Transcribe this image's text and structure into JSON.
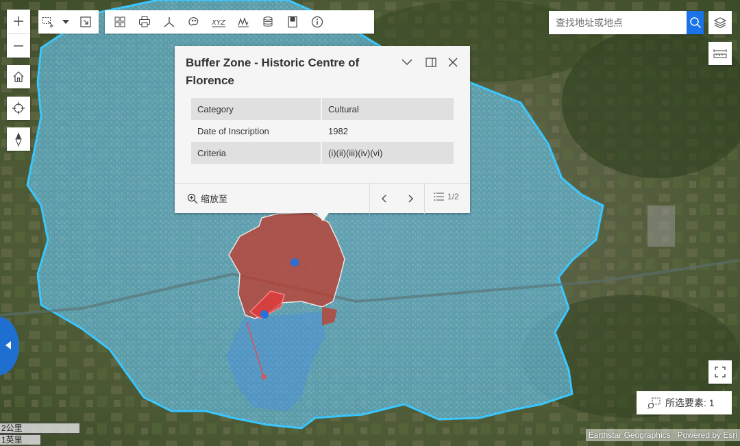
{
  "colors": {
    "buffer_fill": "#5fb6d6",
    "buffer_outline": "#37c6ff",
    "core_fill": "#c0392b",
    "accent": "#1a73e8",
    "sidetab": "#1f6fd1"
  },
  "zoom": {
    "in_icon": "plus-icon",
    "out_icon": "minus-icon"
  },
  "left_tools": [
    "home-icon",
    "locate-icon",
    "compass-icon"
  ],
  "toolbar_a": [
    "select-icon",
    "caret-down-icon",
    "extent-icon"
  ],
  "toolbar_b": [
    "grid-icon",
    "print-icon",
    "coordinate-icon",
    "analysis-icon",
    "xyz-icon",
    "chart-icon",
    "database-icon",
    "bookmark-icon",
    "info-icon"
  ],
  "search": {
    "placeholder": "查找地址或地点"
  },
  "popup": {
    "title": "Buffer Zone - Historic Centre of Florence",
    "rows": [
      {
        "key": "Category",
        "value": "Cultural"
      },
      {
        "key": "Date of Inscription",
        "value": "1982"
      },
      {
        "key": "Criteria",
        "value": "(i)(ii)(iii)(iv)(vi)"
      }
    ],
    "zoom_to": "缩放至",
    "count": "1/2"
  },
  "selection": {
    "label": "所选要素: 1"
  },
  "scale": {
    "km": "2公里",
    "mi": "1英里"
  },
  "attribution": {
    "source": "Earthstar Geographics",
    "powered": "Powered by Esri"
  }
}
